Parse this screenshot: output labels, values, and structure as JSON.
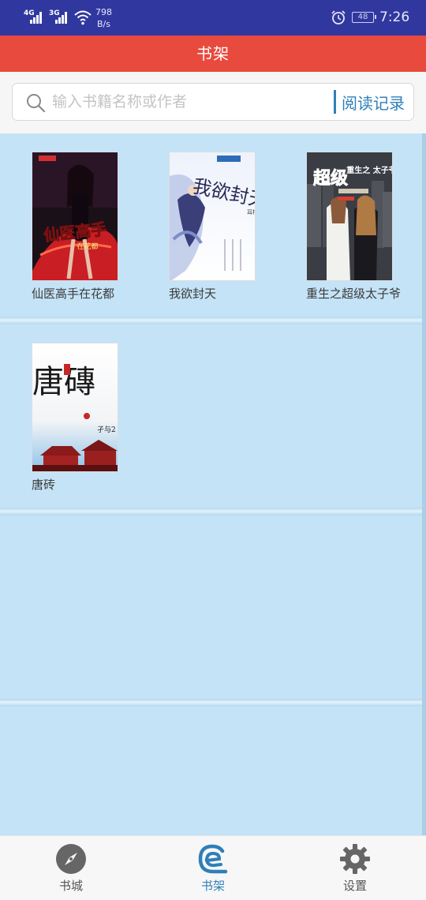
{
  "status_bar": {
    "signal_1": "4G",
    "signal_2": "3G",
    "net_speed_value": "798",
    "net_speed_unit": "B/s",
    "battery": "48",
    "time": "7:26",
    "icons": [
      "signal-icon",
      "wifi-icon",
      "alarm-icon",
      "battery-icon"
    ]
  },
  "header": {
    "title": "书架",
    "color": "#e84a3e"
  },
  "search": {
    "placeholder": "输入书籍名称或作者",
    "value": "",
    "history_label": "阅读记录",
    "accent": "#2f7fb8"
  },
  "books": [
    {
      "title": "仙医高手在花都",
      "cover_text": "仙医高手",
      "cover_subtext": "在花都"
    },
    {
      "title": "我欲封天",
      "cover_text": "我欲封天",
      "cover_subtext": "耳根"
    },
    {
      "title": "重生之超级太子爷",
      "cover_text": "超级",
      "cover_subtext": "重生之 太子爷"
    },
    {
      "title": "唐砖",
      "cover_text": "唐磚",
      "cover_subtext": "孑与2"
    }
  ],
  "bottom_nav": [
    {
      "label": "书城",
      "icon": "compass-icon",
      "active": false
    },
    {
      "label": "书架",
      "icon": "bookshelf-icon",
      "active": true
    },
    {
      "label": "设置",
      "icon": "gear-icon",
      "active": false
    }
  ],
  "colors": {
    "status_bar": "#3038a0",
    "shelf_background": "#c4e3f7",
    "active_tab": "#2f7fb8"
  }
}
